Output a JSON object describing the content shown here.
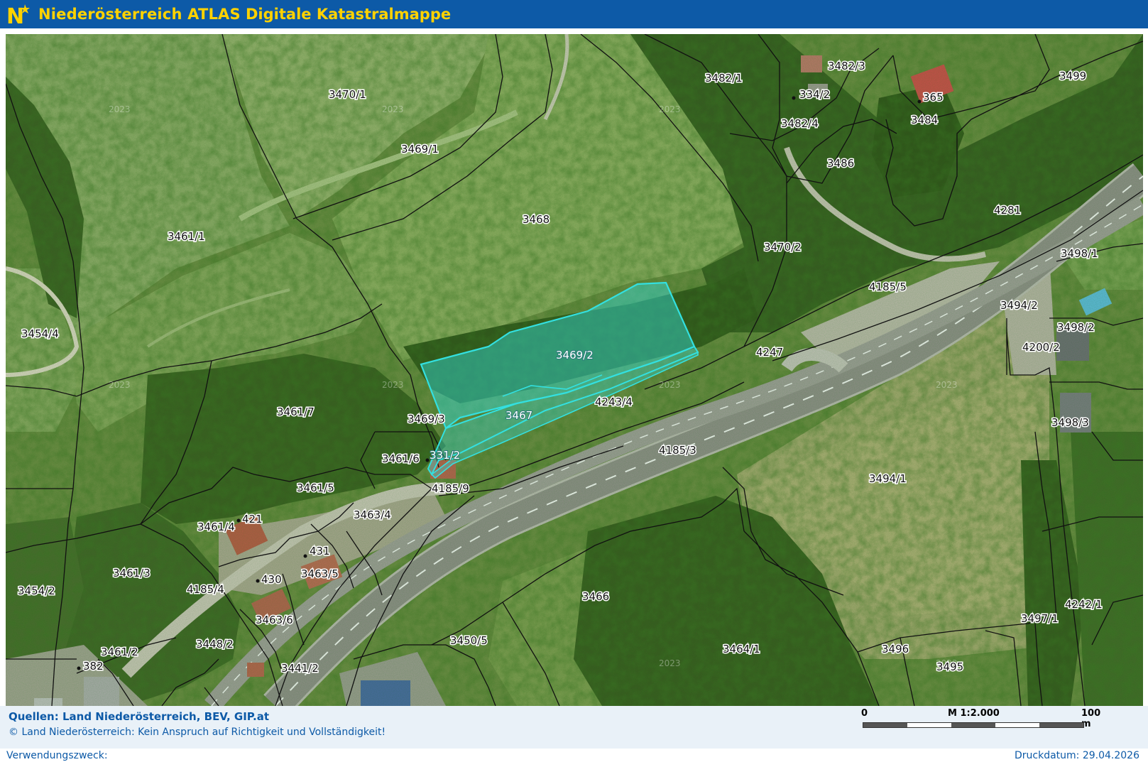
{
  "header": {
    "title": "Niederösterreich ATLAS",
    "subtitle": "Digitale Katastralmappe",
    "logo_letter": "N",
    "bg_color": "#0d5aa7",
    "text_color": "#ffd200"
  },
  "map": {
    "selected_color": "#33e0e0",
    "parcel_labels": [
      "3470/1",
      "3469/1",
      "3482/1",
      "3482/3",
      "334/2",
      "365",
      "3499",
      "3482/4",
      "3484",
      "3486",
      "3468",
      "3461/1",
      "3470/2",
      "4281",
      "3498/1",
      "4185/5",
      "3494/2",
      "3498/2",
      "3454/4",
      "4200/2",
      "3469/2",
      "4247",
      "3461/7",
      "3467",
      "4243/4",
      "3469/3",
      "3498/3",
      "331/2",
      "3461/6",
      "4185/3",
      "3494/1",
      "3461/5",
      "4185/9",
      "421",
      "3463/4",
      "3461/4",
      "431",
      "3461/3",
      "430",
      "3463/5",
      "4185/4",
      "3454/2",
      "3466",
      "4242/1",
      "3463/6",
      "3497/1",
      "3448/2",
      "3450/5",
      "3464/1",
      "3496",
      "3461/2",
      "3495",
      "382",
      "3441/2"
    ],
    "selected_parcel": "3469/2",
    "watermark_text": "2023"
  },
  "footer": {
    "sources": "Quellen: Land Niederösterreich, BEV, GIP.at",
    "copyright": "© Land Niederösterreich: Kein Anspruch auf Richtigkeit und Vollständigkeit!",
    "scale_start": "0",
    "scale_label": "M 1:2.000",
    "scale_end": "100 m",
    "purpose_label": "Verwendungszweck:",
    "print_date": "Druckdatum: 29.04.2026"
  }
}
